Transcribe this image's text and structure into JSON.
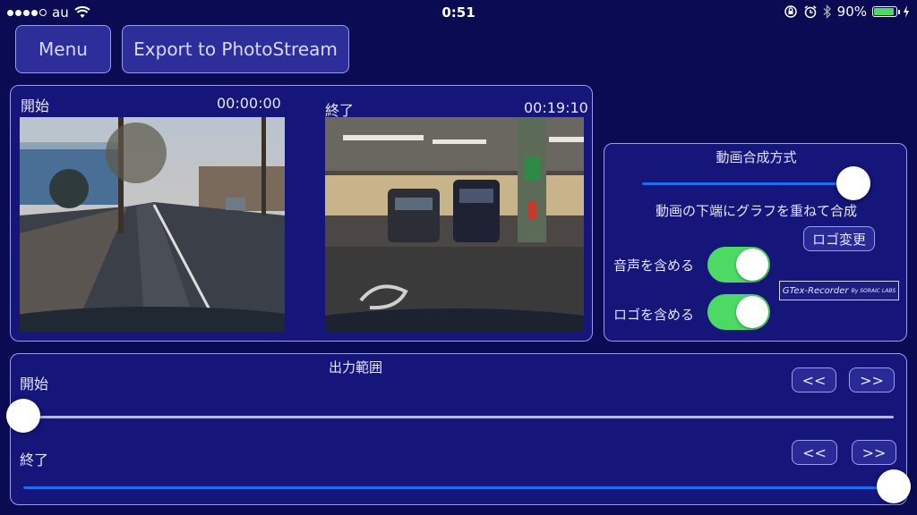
{
  "status_bar": {
    "carrier": "au",
    "time": "0:51",
    "battery_percent": "90%",
    "battery_level": 0.9,
    "icons": [
      "signal-dots-icon",
      "wifi-icon",
      "rotation-lock-icon",
      "alarm-icon",
      "bluetooth-icon",
      "battery-icon",
      "charging-icon"
    ]
  },
  "toolbar": {
    "menu_label": "Menu",
    "export_label": "Export to PhotoStream"
  },
  "preview": {
    "start_label": "開始",
    "start_time": "00:00:00",
    "end_label": "終了",
    "end_time": "00:19:10"
  },
  "composition": {
    "title": "動画合成方式",
    "slider_value": 1.0,
    "mode_text": "動画の下端にグラフを重ねて合成",
    "logo_change_label": "ロゴ変更",
    "include_audio_label": "音声を含める",
    "include_audio": true,
    "include_logo_label": "ロゴを含める",
    "include_logo": true,
    "logo_text": "GTex-Recorder",
    "logo_subtext": "By SORAIC LABS"
  },
  "output_range": {
    "title": "出力範囲",
    "start_label": "開始",
    "start_value": 0.0,
    "end_label": "終了",
    "end_value": 1.0,
    "prev_label": "<<",
    "next_label": ">>"
  },
  "colors": {
    "background": "#0b0b54",
    "panel": "#15157a",
    "border": "#9c9cf0",
    "toggle_on": "#4cd964",
    "slider_blue": "#1e6cf0",
    "slider_gray": "#b8b8c8"
  }
}
